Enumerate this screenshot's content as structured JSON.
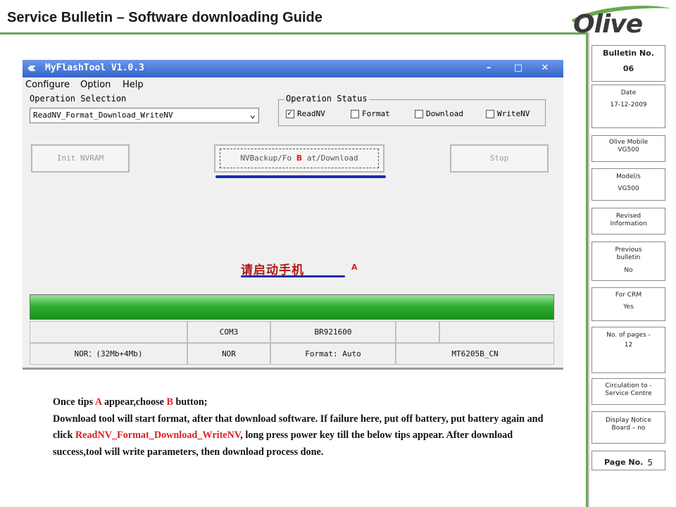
{
  "slide": {
    "title": "Service Bulletin – Software downloading Guide",
    "logo_text": "Olive",
    "colors": {
      "accent_green": "#6aa84f",
      "marker_red": "#e02020",
      "underline_blue": "#1a2fa8"
    }
  },
  "sidebar": {
    "bulletin_label": "Bulletin No.",
    "bulletin_value": "06",
    "date_label": "Date",
    "date_value": "17-12-2009",
    "product_label": "Olive Mobile",
    "product_value": "VG500",
    "model_label": "Model/s",
    "model_value": "VG500",
    "revised_label": "Revised Information",
    "previous_label": "Previous bulletin",
    "previous_value": "No",
    "crm_label": "For CRM",
    "crm_value": "Yes",
    "pages_label": "No. of pages -",
    "pages_value": "12",
    "circulation_label": "Circulation to - Service Centre",
    "notice_label": "Display Notice Board – no",
    "page_label": "Page No.",
    "page_value": "5"
  },
  "tool": {
    "window_title": "MyFlashTool V1.0.3",
    "window_buttons": {
      "minimize": "–",
      "maximize": "□",
      "close": "✕"
    },
    "menu": [
      "Configure",
      "Option",
      "Help"
    ],
    "operation_selection_label": "Operation Selection",
    "operation_selection_value": "ReadNV_Format_Download_WriteNV",
    "operation_status_label": "Operation Status",
    "status_checks": [
      {
        "label": "ReadNV",
        "checked": true
      },
      {
        "label": "Format",
        "checked": false
      },
      {
        "label": "Download",
        "checked": false
      },
      {
        "label": "WriteNV",
        "checked": false
      }
    ],
    "init_button": "Init NVRAM",
    "main_button_left": "NVBackup/Fo",
    "main_button_marker": "B",
    "main_button_right": "at/Download",
    "stop_button": "Stop",
    "chinese_tip": "请启动手机",
    "tip_marker": "A",
    "progress_fraction": 1.0,
    "info_row1": [
      "",
      "COM3",
      "BR921600",
      "",
      ""
    ],
    "info_row2": [
      "NOR：(32Mb+4Mb)",
      "NOR",
      "Format: Auto",
      "MT6205B_CN"
    ]
  },
  "description": {
    "line1_pre": "Once tips ",
    "line1_a": "A",
    "line1_mid": " appear,choose ",
    "line1_b": "B",
    "line1_post": " button;",
    "body_pre": "Download tool will start format, after that download software. If failure here, put off battery, put battery again and click ",
    "body_link": "ReadNV_Format_Download_WriteNV",
    "body_post": ", long press power key till the below tips appear. After download success,tool will write parameters, then download process done."
  }
}
